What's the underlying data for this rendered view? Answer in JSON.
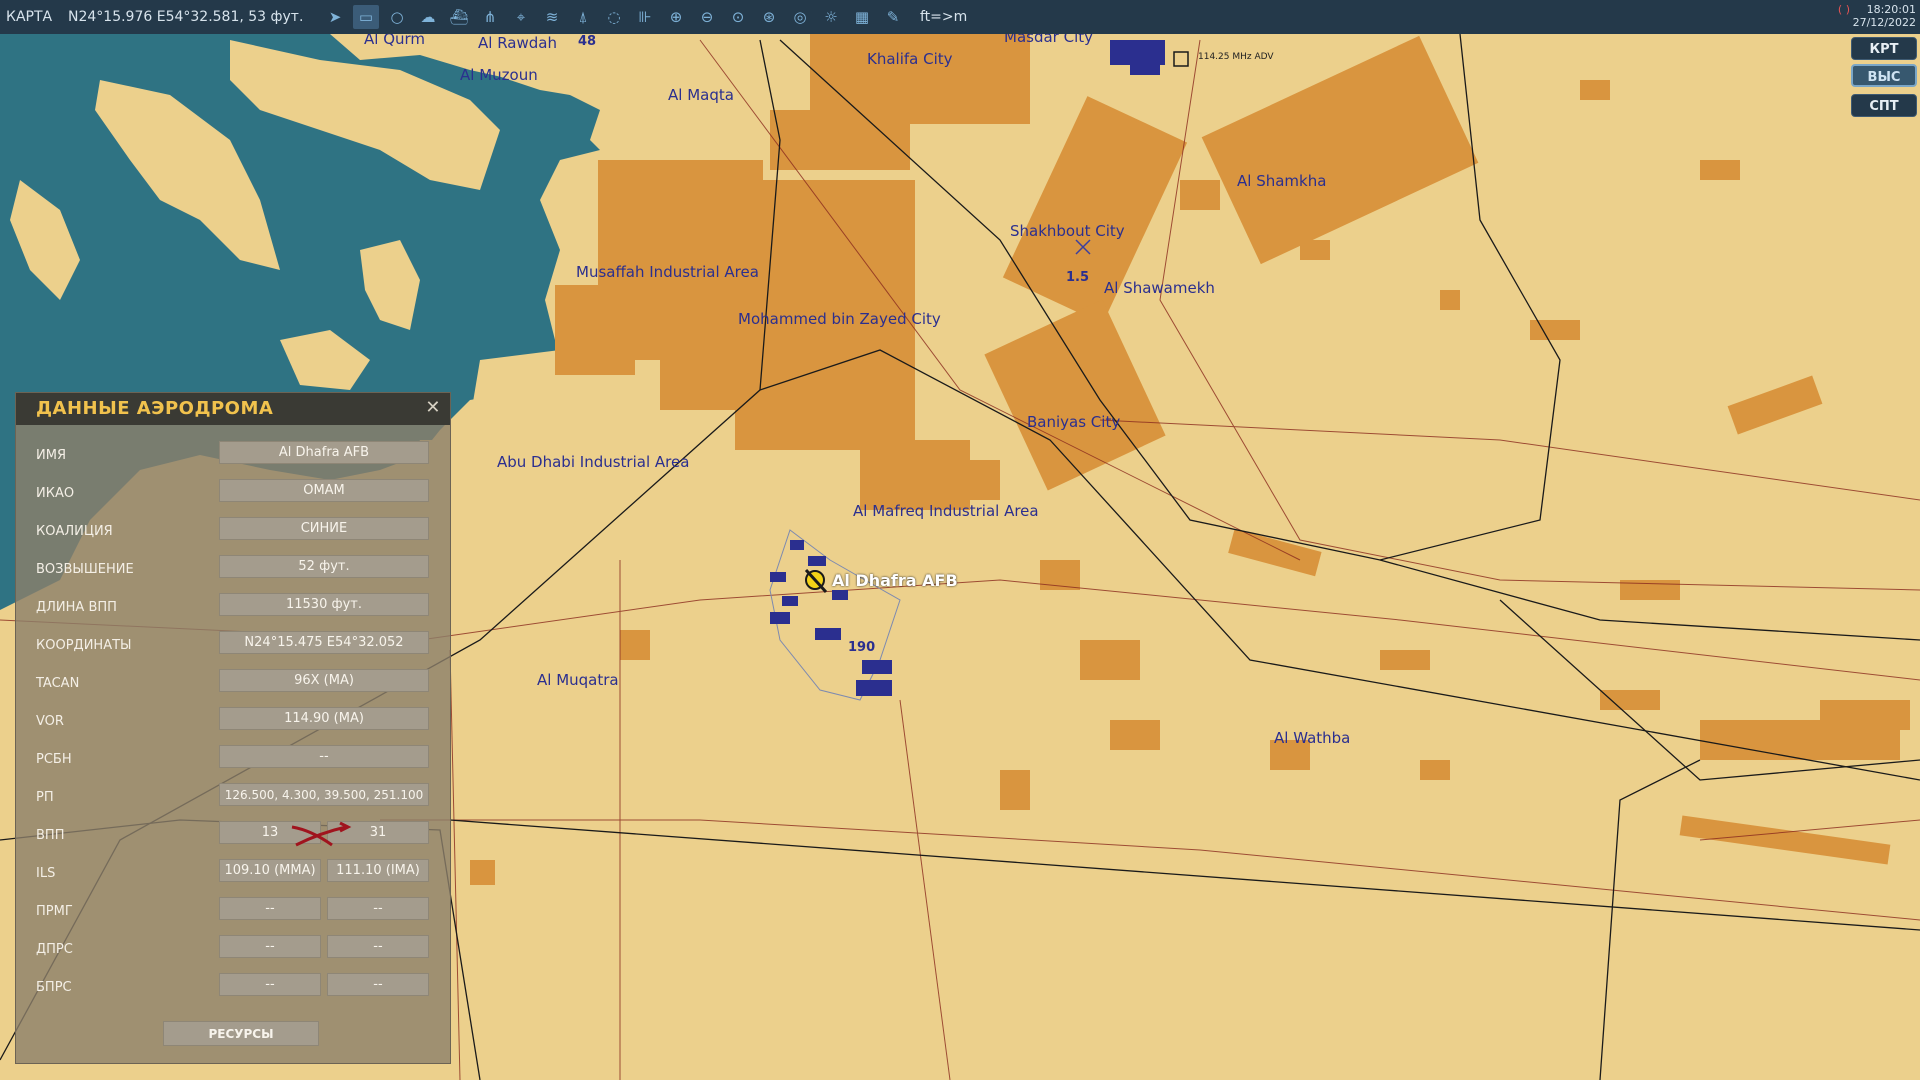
{
  "topbar": {
    "mode": "КАРТА",
    "cursor_coords": "N24°15.976 E54°32.581, 53 фут.",
    "units_toggle": "ft=>m",
    "time": "18:20:01",
    "date": "27/12/2022",
    "rec_indicator": "( )",
    "tools": [
      {
        "name": "arrow-icon",
        "glyph": "➤"
      },
      {
        "name": "rectangle-tool-icon",
        "glyph": "▭"
      },
      {
        "name": "circle-tool-icon",
        "glyph": "○"
      },
      {
        "name": "clouds-icon",
        "glyph": "☁"
      },
      {
        "name": "ships-icon",
        "glyph": "⛴"
      },
      {
        "name": "waypoint-net-icon",
        "glyph": "⋔"
      },
      {
        "name": "target-icon",
        "glyph": "⌖"
      },
      {
        "name": "wifi-icon",
        "glyph": "≋"
      },
      {
        "name": "tower-icon",
        "glyph": "⍋"
      },
      {
        "name": "chat-icon",
        "glyph": "◌"
      },
      {
        "name": "ruler-icon",
        "glyph": "⊪"
      },
      {
        "name": "zoom-in-icon",
        "glyph": "⊕"
      },
      {
        "name": "zoom-out-icon",
        "glyph": "⊖"
      },
      {
        "name": "zoom-fit-icon",
        "glyph": "⊙"
      },
      {
        "name": "globe-icon",
        "glyph": "⊛"
      },
      {
        "name": "radar-icon",
        "glyph": "◎"
      },
      {
        "name": "sun-icon",
        "glyph": "☼"
      },
      {
        "name": "grid-icon",
        "glyph": "▦"
      },
      {
        "name": "pencil-icon",
        "glyph": "✎"
      }
    ]
  },
  "right_buttons": [
    {
      "label": "КРТ",
      "active": false
    },
    {
      "label": "ВЫС",
      "active": true
    },
    {
      "label": "СПТ",
      "active": false
    }
  ],
  "map": {
    "labels": [
      "Al Qurm",
      "Al Rawdah",
      "Al Muzoun",
      "Al Maqta",
      "Khalifa City",
      "Masdar City",
      "Al Shamkha",
      "Shakhbout City",
      "Al Shawamekh",
      "Musaffah Industrial Area",
      "Mohammed bin Zayed City",
      "Baniyas City",
      "Abu Dhabi Industrial Area",
      "Al Mafreq Industrial Area",
      "Al Muqatra",
      "Al Wathba"
    ],
    "airfield_name": "Al Dhafra AFB",
    "navaid_label": "114.25 MHz ADV",
    "marker_values": [
      "190",
      "1.5",
      "48"
    ]
  },
  "panel": {
    "title": "ДАННЫЕ АЭРОДРОМА",
    "rows": [
      {
        "key": "ИМЯ",
        "value": "Al Dhafra AFB"
      },
      {
        "key": "ИКАО",
        "value": "OMAM"
      },
      {
        "key": "КОАЛИЦИЯ",
        "value": "СИНИЕ"
      },
      {
        "key": "ВОЗВЫШЕНИЕ",
        "value": "52 фут."
      },
      {
        "key": "ДЛИНА ВПП",
        "value": "11530 фут."
      },
      {
        "key": "КООРДИНАТЫ",
        "value": "N24°15.475 E54°32.052"
      },
      {
        "key": "TACAN",
        "value": "96X (MA)"
      },
      {
        "key": "VOR",
        "value": "114.90 (MA)"
      },
      {
        "key": "РСБН",
        "value": "--"
      },
      {
        "key": "РП",
        "value": "126.500, 4.300, 39.500, 251.100"
      }
    ],
    "pair_rows": [
      {
        "key": "ВПП",
        "left": "13",
        "right": "31"
      },
      {
        "key": "ILS",
        "left": "109.10 (MMA)",
        "right": "111.10 (IMA)"
      },
      {
        "key": "ПРМГ",
        "left": "--",
        "right": "--"
      },
      {
        "key": "ДПРС",
        "left": "--",
        "right": "--"
      },
      {
        "key": "БПРС",
        "left": "--",
        "right": "--"
      }
    ],
    "resources_label": "РЕСУРСЫ"
  },
  "colors": {
    "water": "#2f7383",
    "land": "#ecd08c",
    "urban": "#d9953f",
    "road": "#8a2a1e",
    "topbar": "#24394a",
    "panel_title": "#f1c24d"
  }
}
